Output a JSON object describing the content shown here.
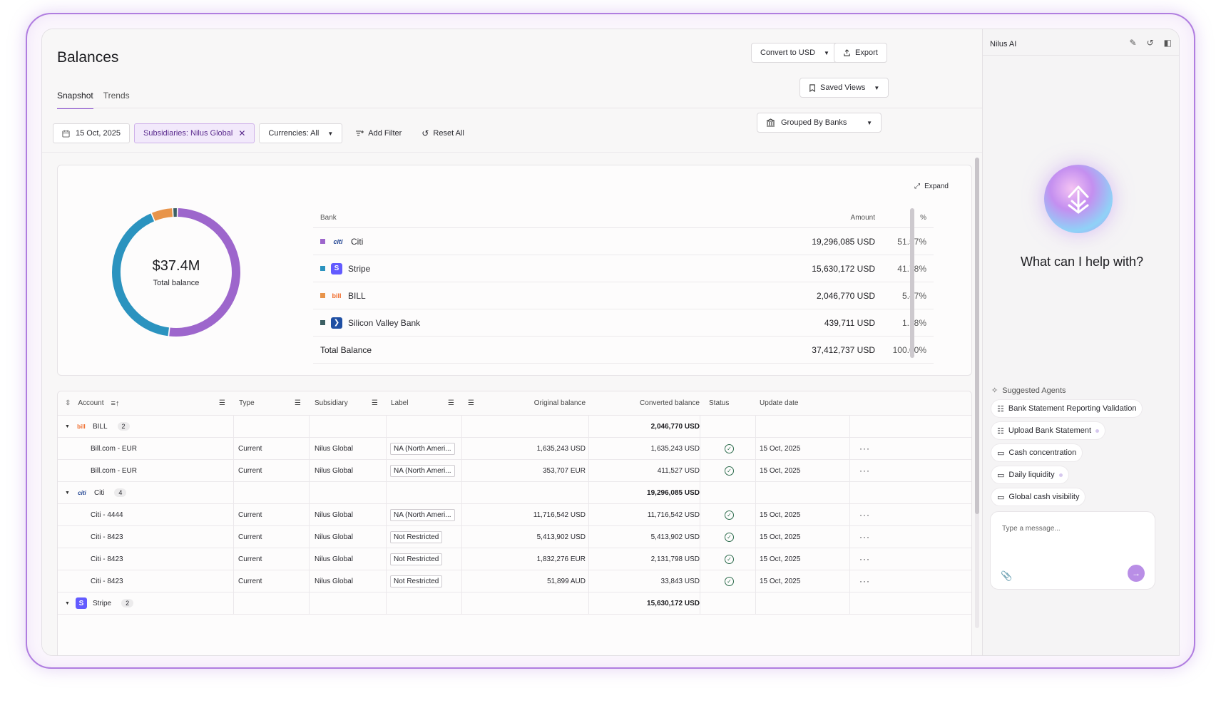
{
  "header": {
    "title": "Balances",
    "convert_label": "Convert to USD",
    "export_label": "Export",
    "saved_views_label": "Saved Views"
  },
  "tabs": [
    {
      "label": "Snapshot",
      "active": true
    },
    {
      "label": "Trends",
      "active": false
    }
  ],
  "filters": {
    "date": "15 Oct, 2025",
    "subsidiaries": "Subsidiaries: Nilus Global",
    "currencies": "Currencies: All",
    "add_filter": "Add Filter",
    "reset_all": "Reset All",
    "grouped_by": "Grouped By Banks"
  },
  "summary": {
    "total_value": "$37.4M",
    "total_label": "Total balance",
    "expand_label": "Expand",
    "columns": {
      "bank": "Bank",
      "amount": "Amount",
      "pct": "%"
    },
    "banks": [
      {
        "name": "Citi",
        "amount": "19,296,085 USD",
        "pct": "51.57%",
        "share": 51.57,
        "color": "#9d66cc",
        "logo": "citi-logo"
      },
      {
        "name": "Stripe",
        "amount": "15,630,172 USD",
        "pct": "41.78%",
        "share": 41.78,
        "color": "#2b93bf",
        "logo": "stripe-logo"
      },
      {
        "name": "BILL",
        "amount": "2,046,770 USD",
        "pct": "5.47%",
        "share": 5.47,
        "color": "#e8944a",
        "logo": "bill-logo"
      },
      {
        "name": "Silicon Valley Bank",
        "amount": "439,711 USD",
        "pct": "1.18%",
        "share": 1.18,
        "color": "#3c5f63",
        "logo": "svb-logo"
      }
    ],
    "total_row": {
      "label": "Total Balance",
      "amount": "37,412,737 USD",
      "pct": "100.00%"
    }
  },
  "accounts": {
    "columns": {
      "account": "Account",
      "type": "Type",
      "subsidiary": "Subsidiary",
      "label": "Label",
      "original": "Original balance",
      "converted": "Converted balance",
      "status": "Status",
      "update": "Update date"
    },
    "rows": [
      {
        "kind": "group",
        "name": "BILL",
        "count": "2",
        "converted": "2,046,770 USD",
        "logo": "bill"
      },
      {
        "kind": "item",
        "name": "Bill.com - EUR",
        "type": "Current",
        "subsidiary": "Nilus Global",
        "label": "NA (North Ameri...",
        "original": "1,635,243 USD",
        "converted": "1,635,243 USD",
        "date": "15 Oct, 2025"
      },
      {
        "kind": "item",
        "name": "Bill.com - EUR",
        "type": "Current",
        "subsidiary": "Nilus Global",
        "label": "NA (North Ameri...",
        "original": "353,707 EUR",
        "converted": "411,527 USD",
        "date": "15 Oct, 2025"
      },
      {
        "kind": "group",
        "name": "Citi",
        "count": "4",
        "converted": "19,296,085 USD",
        "logo": "citi"
      },
      {
        "kind": "item",
        "name": "Citi - 4444",
        "type": "Current",
        "subsidiary": "Nilus Global",
        "label": "NA (North Ameri...",
        "original": "11,716,542 USD",
        "converted": "11,716,542 USD",
        "date": "15 Oct, 2025"
      },
      {
        "kind": "item",
        "name": "Citi - 8423",
        "type": "Current",
        "subsidiary": "Nilus Global",
        "label": "Not Restricted",
        "original": "5,413,902 USD",
        "converted": "5,413,902 USD",
        "date": "15 Oct, 2025"
      },
      {
        "kind": "item",
        "name": "Citi - 8423",
        "type": "Current",
        "subsidiary": "Nilus Global",
        "label": "Not Restricted",
        "original": "1,832,276 EUR",
        "converted": "2,131,798 USD",
        "date": "15 Oct, 2025"
      },
      {
        "kind": "item",
        "name": "Citi - 8423",
        "type": "Current",
        "subsidiary": "Nilus Global",
        "label": "Not Restricted",
        "original": "51,899 AUD",
        "converted": "33,843 USD",
        "date": "15 Oct, 2025"
      },
      {
        "kind": "group",
        "name": "Stripe",
        "count": "2",
        "converted": "15,630,172 USD",
        "logo": "stripe"
      }
    ]
  },
  "ai": {
    "title": "Nilus AI",
    "prompt": "What can I help with?",
    "suggested_title": "Suggested Agents",
    "suggestions": [
      "Bank Statement Reporting Validation",
      "Upload Bank Statement",
      "Cash concentration",
      "Daily liquidity",
      "Global cash visibility"
    ],
    "input_placeholder": "Type a message..."
  }
}
